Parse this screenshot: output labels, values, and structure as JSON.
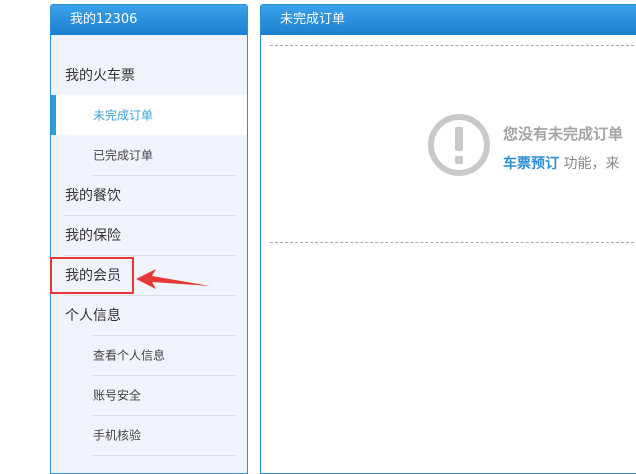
{
  "sidebar": {
    "title": "我的12306",
    "items": [
      {
        "label": "我的火车票"
      },
      {
        "label": "未完成订单"
      },
      {
        "label": "已完成订单"
      },
      {
        "label": "我的餐饮"
      },
      {
        "label": "我的保险"
      },
      {
        "label": "我的会员"
      },
      {
        "label": "个人信息"
      },
      {
        "label": "查看个人信息"
      },
      {
        "label": "账号安全"
      },
      {
        "label": "手机核验"
      }
    ]
  },
  "main": {
    "title": "未完成订单",
    "message_line1": "您没有未完成订单",
    "link_text": "车票预订",
    "message_line2_rest": " 功能，来"
  },
  "colors": {
    "header_blue": "#1a7fd0",
    "highlight_red": "#e53935",
    "link_blue": "#2b8fd6"
  },
  "icons": {
    "warning": "exclamation-circle-icon",
    "annotation": "red-arrow-icon"
  }
}
